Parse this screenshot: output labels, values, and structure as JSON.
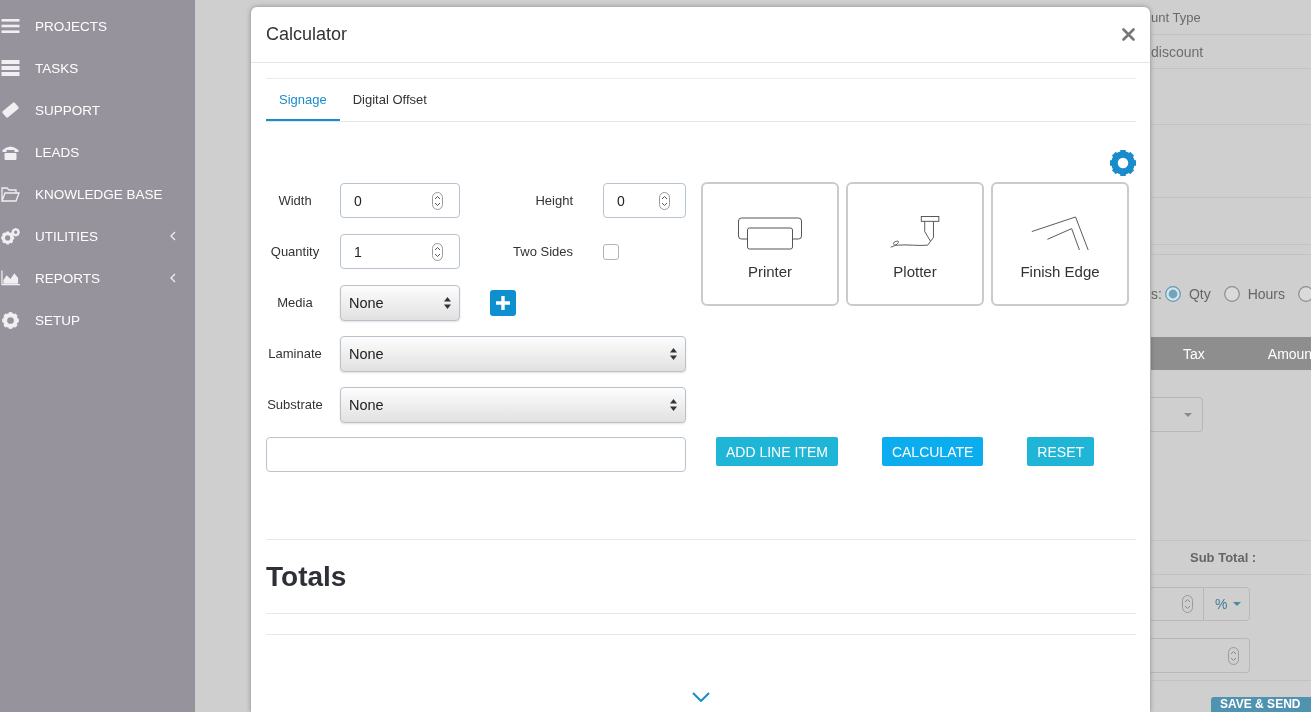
{
  "sidebar": {
    "items": [
      {
        "label": "PROJECTS",
        "submenu": false
      },
      {
        "label": "TASKS",
        "submenu": false
      },
      {
        "label": "SUPPORT",
        "submenu": false
      },
      {
        "label": "LEADS",
        "submenu": false
      },
      {
        "label": "KNOWLEDGE BASE",
        "submenu": false
      },
      {
        "label": "UTILITIES",
        "submenu": true
      },
      {
        "label": "REPORTS",
        "submenu": true
      },
      {
        "label": "SETUP",
        "submenu": false
      }
    ]
  },
  "background": {
    "discount_type_label": "unt Type",
    "discount_placeholder": "discount",
    "units_label": "s:",
    "units": [
      {
        "label": "Qty",
        "selected": true
      },
      {
        "label": "Hours",
        "selected": false
      },
      {
        "selected": false
      }
    ],
    "table_columns": [
      "Tax",
      "Amoun"
    ],
    "subtotal_label": "Sub Total :",
    "discount_unit": "%",
    "save_button": "SAVE & SEND"
  },
  "modal": {
    "title": "Calculator",
    "tabs": [
      {
        "label": "Signage",
        "selected": true
      },
      {
        "label": "Digital Offset",
        "selected": false
      }
    ],
    "rows": [
      [
        {
          "kind": "number",
          "label": "Width",
          "value": "0"
        },
        {
          "kind": "number",
          "label": "Height",
          "value": "0"
        }
      ],
      [
        {
          "kind": "number",
          "label": "Quantity",
          "value": "1"
        },
        {
          "kind": "checkbox",
          "label": "Two Sides",
          "checked": false
        }
      ],
      [
        {
          "kind": "select",
          "label": "Media",
          "value": "None"
        },
        {
          "kind": "add"
        }
      ],
      [
        {
          "kind": "select",
          "label": "Laminate",
          "value": "None"
        }
      ],
      [
        {
          "kind": "select",
          "label": "Substrate",
          "value": "None"
        }
      ]
    ],
    "tiles": [
      {
        "label": "Printer"
      },
      {
        "label": "Plotter"
      },
      {
        "label": "Finish Edge"
      }
    ],
    "buttons": [
      {
        "label": "ADD LINE ITEM",
        "kind": "info"
      },
      {
        "label": "CALCULATE",
        "kind": "primary"
      },
      {
        "label": "RESET",
        "kind": "info"
      }
    ],
    "section_title": "Totals"
  }
}
